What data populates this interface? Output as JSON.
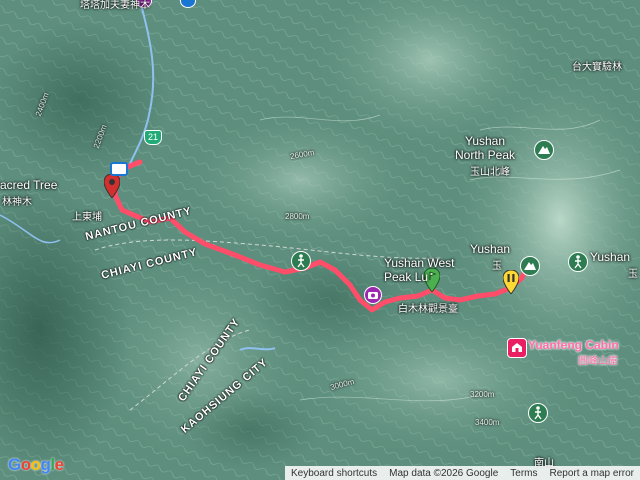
{
  "map": {
    "labels": {
      "top_temple": "塔塔加夫妻神木",
      "sacred_tree": "acred Tree",
      "sacred_tree_zh": "林神木",
      "shangdongpu": "上東埔",
      "forest_station": "台大實驗林",
      "north_peak": "Yushan\nNorth Peak",
      "north_peak_zh": "玉山北峰",
      "yushan": "Yushan",
      "yushan_zh": "玉",
      "yushan_right": "Yushan",
      "yushan_right_zh": "玉",
      "west_peak": "Yushan West\nPeak Lu",
      "baimulin": "白木林觀景臺",
      "cabin": "Yuanfeng Cabin",
      "cabin_zh": "圓峰山屋",
      "nanshan": "南山"
    },
    "counties": {
      "nantou": "NANTOU COUNTY",
      "chiayi_1": "CHIAYI COUNTY",
      "chiayi_2": "CHIAYI COUNTY",
      "kaohsiung": "KAOHSIUNG CITY"
    },
    "highway": "21",
    "elevations": [
      "2600m",
      "2800m",
      "3000m",
      "3200m",
      "3400m",
      "2400m",
      "2200m"
    ]
  },
  "attribution": {
    "keyboard": "Keyboard shortcuts",
    "data": "Map data ©2026 Google",
    "terms": "Terms",
    "report": "Report a map error"
  },
  "logo": "Google",
  "colors": {
    "route": "#ff4d6a",
    "terrain": "#5e8f7e",
    "river": "#8fc1f0"
  }
}
